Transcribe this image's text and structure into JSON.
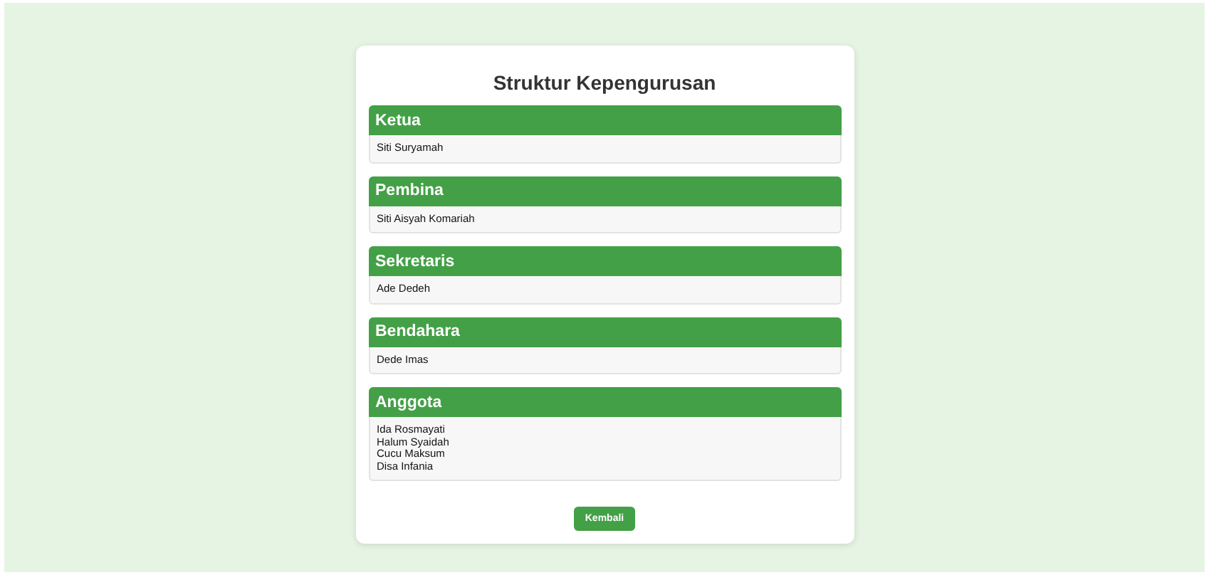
{
  "title": "Struktur Kepengurusan",
  "sections": [
    {
      "heading": "Ketua",
      "members": [
        "Siti Suryamah"
      ]
    },
    {
      "heading": "Pembina",
      "members": [
        "Siti Aisyah Komariah"
      ]
    },
    {
      "heading": "Sekretaris",
      "members": [
        "Ade Dedeh"
      ]
    },
    {
      "heading": "Bendahara",
      "members": [
        "Dede Imas"
      ]
    },
    {
      "heading": "Anggota",
      "members": [
        "Ida Rosmayati",
        "Halum Syaidah",
        "Cucu Maksum",
        "Disa Infania"
      ]
    }
  ],
  "button": "Kembali"
}
